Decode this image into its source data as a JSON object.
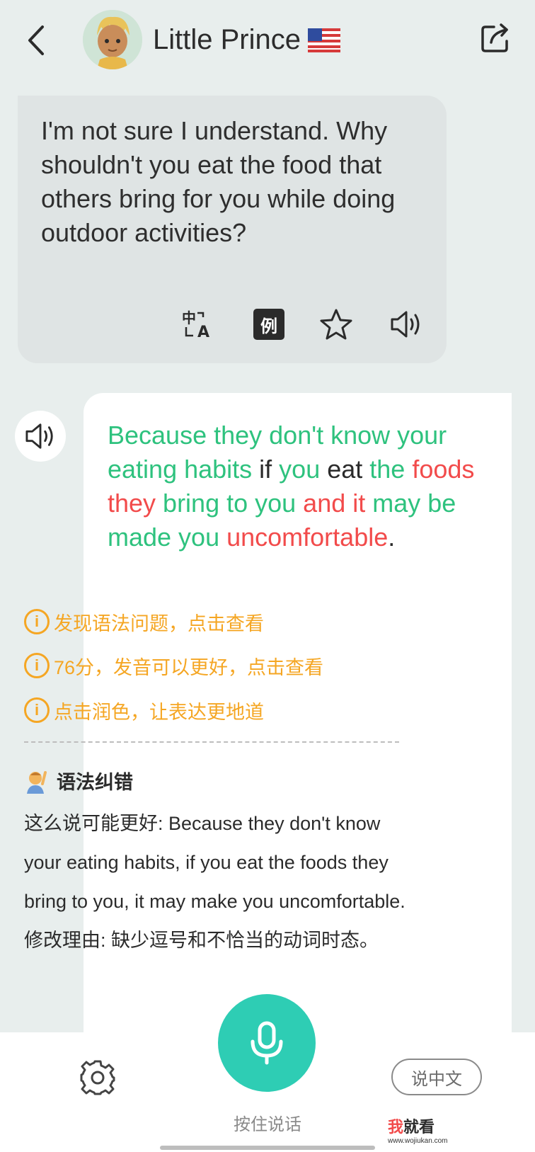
{
  "header": {
    "title": "Little Prince",
    "flag": "🇺🇸"
  },
  "ai_message": {
    "text": "I'm not sure I understand. Why shouldn't you eat the food that others bring for you while doing outdoor activities?",
    "example_label": "例",
    "tool_icons": [
      "translate-icon",
      "example-icon",
      "star-icon",
      "speaker-icon"
    ]
  },
  "user_message": {
    "segments": [
      {
        "text": "Because they don't know your eating habits",
        "color": "green"
      },
      {
        "text": " if ",
        "color": "black"
      },
      {
        "text": "you",
        "color": "green"
      },
      {
        "text": " eat ",
        "color": "black"
      },
      {
        "text": "the ",
        "color": "green"
      },
      {
        "text": "foods they",
        "color": "red"
      },
      {
        "text": " bring to you ",
        "color": "green"
      },
      {
        "text": "and it",
        "color": "red"
      },
      {
        "text": " may be made you ",
        "color": "green"
      },
      {
        "text": "uncomfortable",
        "color": "red"
      },
      {
        "text": ".",
        "color": "black"
      }
    ],
    "hints": [
      "发现语法问题，点击查看",
      "76分，发音可以更好，点击查看",
      "点击润色，让表达更地道"
    ],
    "hint_icon_glyph": "i",
    "grammar": {
      "heading": "语法纠错",
      "suggestion": "这么说可能更好: Because they don't know your eating habits, if you eat the foods they bring to you, it may make you uncomfortable.",
      "reason": "修改理由: 缺少逗号和不恰当的动词时态。"
    }
  },
  "bottom": {
    "mic_label": "按住说话",
    "chinese_button": "说中文",
    "watermark_main": "我就看",
    "watermark_url": "www.wojiukan.com"
  },
  "colors": {
    "green": "#2ec27e",
    "red": "#f24b4b",
    "orange": "#f5a623",
    "mic": "#2ecdb4"
  }
}
